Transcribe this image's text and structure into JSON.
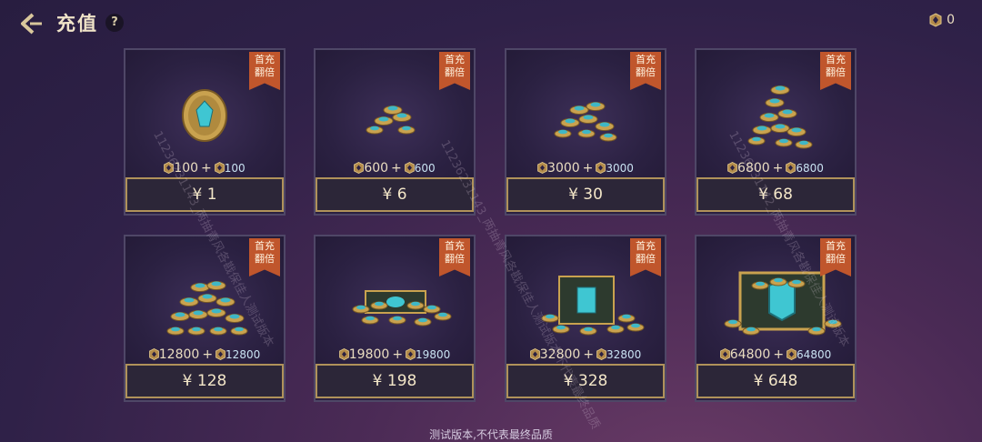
{
  "header": {
    "title": "充值",
    "help": "?",
    "currency_amount": "0"
  },
  "cards": [
    {
      "ribbon": "首充\n翻倍",
      "base": "100",
      "bonus": "100",
      "price": "¥  1",
      "art": "single-coin"
    },
    {
      "ribbon": "首充\n翻倍",
      "base": "600",
      "bonus": "600",
      "price": "¥  6",
      "art": "small-pile"
    },
    {
      "ribbon": "首充\n翻倍",
      "base": "3000",
      "bonus": "3000",
      "price": "¥ 30",
      "art": "pile"
    },
    {
      "ribbon": "首充\n翻倍",
      "base": "6800",
      "bonus": "6800",
      "price": "¥ 68",
      "art": "tall-pile"
    },
    {
      "ribbon": "首充\n翻倍",
      "base": "12800",
      "bonus": "12800",
      "price": "¥ 128",
      "art": "large-pile"
    },
    {
      "ribbon": "首充\n翻倍",
      "base": "19800",
      "bonus": "19800",
      "price": "¥ 198",
      "art": "chest-low"
    },
    {
      "ribbon": "首充\n翻倍",
      "base": "32800",
      "bonus": "32800",
      "price": "¥ 328",
      "art": "chest"
    },
    {
      "ribbon": "首充\n翻倍",
      "base": "64800",
      "bonus": "64800",
      "price": "¥ 648",
      "art": "big-chest"
    }
  ],
  "footer": {
    "note": "测试版本,不代表最终品质"
  },
  "watermarks": [
    "11236231143_两抽青风各戡保佳人测试版本",
    "11236231143_两抽青风各戡保佳人测试版本不代表最终品质",
    "11236231142_两抽青风各戡保佳人测试版本"
  ],
  "colors": {
    "price_border": "#b0925a",
    "ribbon": "#c0562c",
    "card_border": "#4f4767"
  }
}
